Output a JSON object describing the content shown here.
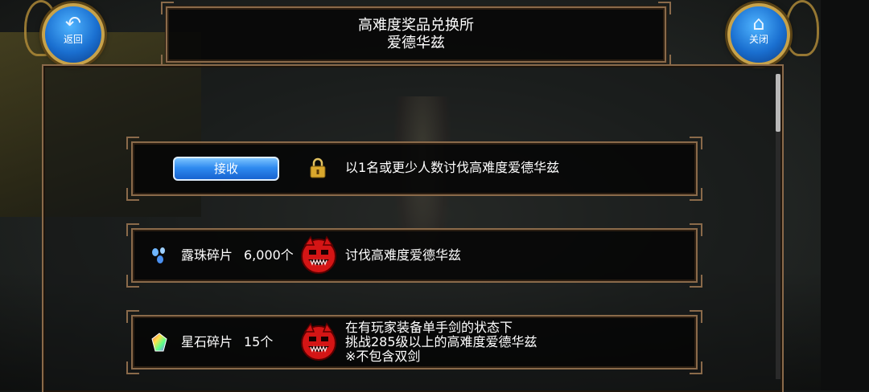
{
  "header": {
    "title_line1": "高难度奖品兑换所",
    "title_line2": "爱德华兹"
  },
  "nav": {
    "back_label": "返回",
    "close_label": "关闭"
  },
  "rows": [
    {
      "button_label": "接收",
      "condition": "以1名或更少人数讨伐高难度爱德华兹"
    },
    {
      "reward_name": "露珠碎片",
      "reward_amount": "6,000个",
      "condition": "讨伐高难度爱德华兹"
    },
    {
      "reward_name": "星石碎片",
      "reward_amount": "15个",
      "condition_line1": "在有玩家装备单手剑的状态下",
      "condition_line2": "挑战285级以上的高难度爱德华兹",
      "condition_note": "※不包含双剑"
    }
  ],
  "colors": {
    "frame_border": "#8a6a4a",
    "button_blue": "#2f8bf0",
    "note_red": "#ff2a2a",
    "boss_red": "#e01818"
  },
  "icons": {
    "back": "back-arrow-icon",
    "close": "home-icon",
    "locked": "padlock-icon",
    "dew_shard": "blue-droplets-icon",
    "star_shard": "rainbow-crystal-icon",
    "boss": "red-demon-emblem-icon"
  }
}
